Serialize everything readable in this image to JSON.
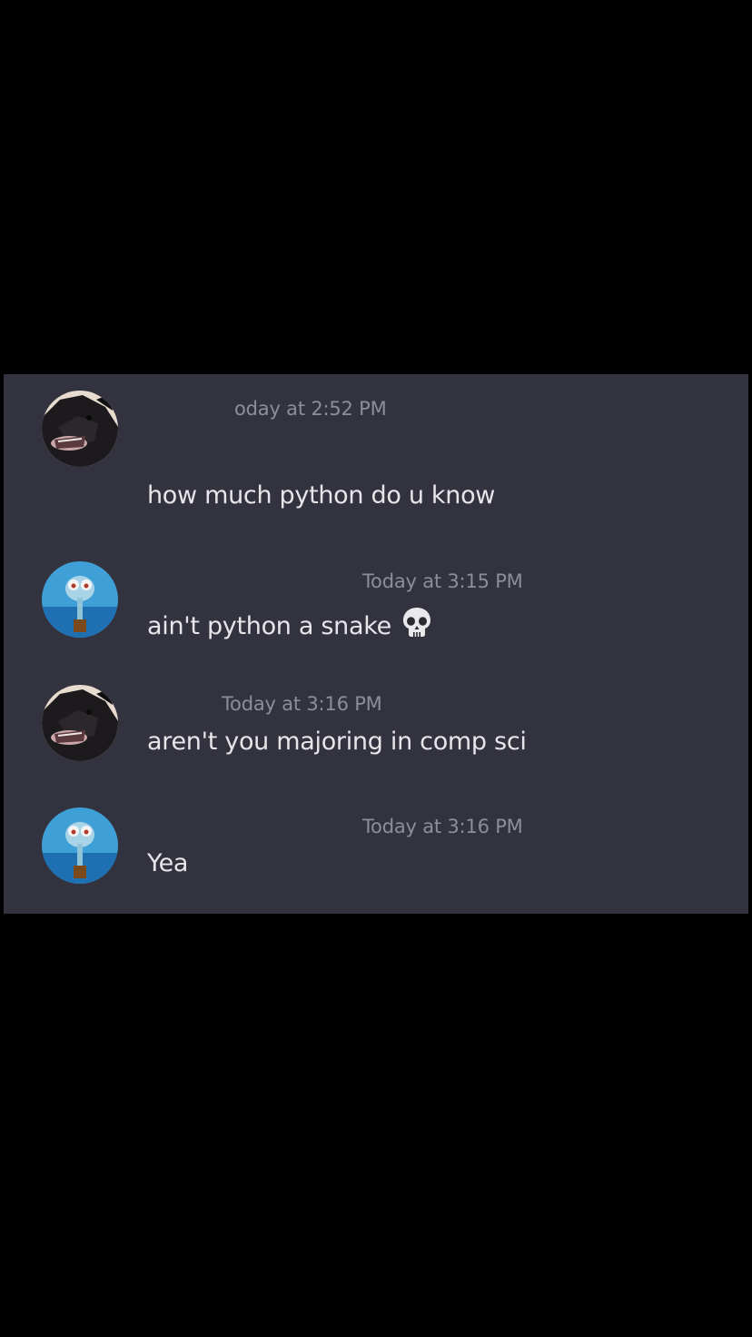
{
  "messages": [
    {
      "author_avatar": "dark-cat-avatar-icon",
      "timestamp": "oday at 2:52 PM",
      "text": "how much python do u know"
    },
    {
      "author_avatar": "squidward-avatar-icon",
      "timestamp": "Today at 3:15 PM",
      "text": "ain't python a snake",
      "emoji": "skull-icon"
    },
    {
      "author_avatar": "dark-cat-avatar-icon",
      "timestamp": "Today at 3:16 PM",
      "text": "aren't you majoring in comp sci"
    },
    {
      "author_avatar": "squidward-avatar-icon",
      "timestamp": "Today at 3:16 PM",
      "text": "Yea"
    }
  ],
  "colors": {
    "page_background": "#000000",
    "panel_background": "#33333f",
    "timestamp": "#8d8e96",
    "message_text": "#e6e6ea"
  }
}
